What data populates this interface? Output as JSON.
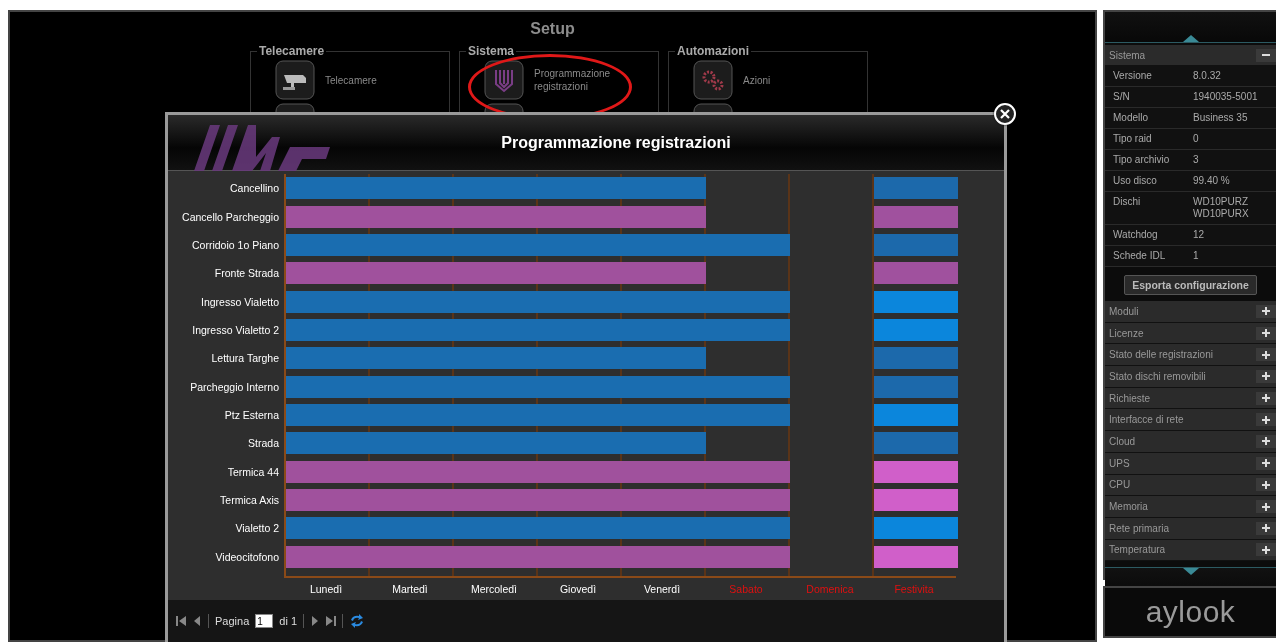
{
  "setup": {
    "title": "Setup",
    "groups": [
      {
        "title": "Telecamere",
        "items": [
          {
            "label": "Telecamere",
            "kind": "camera"
          }
        ]
      },
      {
        "title": "Sistema",
        "items": [
          {
            "label": "Programmazione registrazioni",
            "kind": "schedule"
          }
        ]
      },
      {
        "title": "Automazioni",
        "items": [
          {
            "label": "Azioni",
            "kind": "gears"
          }
        ]
      }
    ]
  },
  "dialog": {
    "title": "Programmazione registrazioni",
    "days": [
      {
        "label": "Lunedì",
        "weekend": false
      },
      {
        "label": "Martedì",
        "weekend": false
      },
      {
        "label": "Mercoledì",
        "weekend": false
      },
      {
        "label": "Giovedì",
        "weekend": false
      },
      {
        "label": "Venerdì",
        "weekend": false
      },
      {
        "label": "Sabato",
        "weekend": true
      },
      {
        "label": "Domenica",
        "weekend": true
      },
      {
        "label": "Festivita",
        "weekend": true
      }
    ],
    "rows": [
      {
        "name": "Cancellino",
        "color": "#1a6db0",
        "days": [
          true,
          true,
          true,
          true,
          true,
          false,
          false
        ],
        "holiday": {
          "color": "#1c69ab"
        }
      },
      {
        "name": "Cancello Parcheggio",
        "color": "#a0519d",
        "days": [
          true,
          true,
          true,
          true,
          true,
          false,
          false
        ],
        "holiday": {
          "color": "#a0519e"
        }
      },
      {
        "name": "Corridoio 1o Piano",
        "color": "#1a6db0",
        "days": [
          true,
          true,
          true,
          true,
          true,
          true,
          false
        ],
        "holiday": {
          "color": "#1c69ab"
        }
      },
      {
        "name": "Fronte Strada",
        "color": "#a0519d",
        "days": [
          true,
          true,
          true,
          true,
          true,
          false,
          false
        ],
        "holiday": {
          "color": "#a0519e"
        }
      },
      {
        "name": "Ingresso Vialetto",
        "color": "#1a6db0",
        "days": [
          true,
          true,
          true,
          true,
          true,
          true,
          false
        ],
        "holiday": {
          "color": "#0b86dc"
        }
      },
      {
        "name": "Ingresso Vialetto 2",
        "color": "#1a6db0",
        "days": [
          true,
          true,
          true,
          true,
          true,
          true,
          false
        ],
        "holiday": {
          "color": "#0b86dc"
        }
      },
      {
        "name": "Lettura Targhe",
        "color": "#1a6db0",
        "days": [
          true,
          true,
          true,
          true,
          true,
          false,
          false
        ],
        "holiday": {
          "color": "#1c69ab"
        }
      },
      {
        "name": "Parcheggio Interno",
        "color": "#1a6db0",
        "days": [
          true,
          true,
          true,
          true,
          true,
          true,
          false
        ],
        "holiday": {
          "color": "#1c69ab"
        }
      },
      {
        "name": "Ptz Esterna",
        "color": "#1a6db0",
        "days": [
          true,
          true,
          true,
          true,
          true,
          true,
          false
        ],
        "holiday": {
          "color": "#0b86dc"
        }
      },
      {
        "name": "Strada",
        "color": "#1a6db0",
        "days": [
          true,
          true,
          true,
          true,
          true,
          false,
          false
        ],
        "holiday": {
          "color": "#1c69ab"
        }
      },
      {
        "name": "Termica 44",
        "color": "#a0519d",
        "days": [
          true,
          true,
          true,
          true,
          true,
          true,
          false
        ],
        "holiday": {
          "color": "#d05fc9"
        }
      },
      {
        "name": "Termica Axis",
        "color": "#a0519d",
        "days": [
          true,
          true,
          true,
          true,
          true,
          true,
          false
        ],
        "holiday": {
          "color": "#d05fc9"
        }
      },
      {
        "name": "Vialetto 2",
        "color": "#1a6db0",
        "days": [
          true,
          true,
          true,
          true,
          true,
          true,
          false
        ],
        "holiday": {
          "color": "#0b86dc"
        }
      },
      {
        "name": "Videocitofono",
        "color": "#a0519d",
        "days": [
          true,
          true,
          true,
          true,
          true,
          true,
          false
        ],
        "holiday": {
          "color": "#d05fc9"
        }
      }
    ],
    "pager": {
      "page_label": "Pagina",
      "page": "1",
      "total": "di 1"
    }
  },
  "sidebar": {
    "section": {
      "title": "Sistema",
      "expanded": true
    },
    "info": [
      {
        "label": "Versione",
        "value": "8.0.32"
      },
      {
        "label": "S/N",
        "value": "1940035-5001"
      },
      {
        "label": "Modello",
        "value": "Business 35"
      },
      {
        "label": "Tipo raid",
        "value": "0"
      },
      {
        "label": "Tipo archivio",
        "value": "3"
      },
      {
        "label": "Uso disco",
        "value": "99.40 %"
      },
      {
        "label": "Dischi",
        "value": "WD10PURZ\nWD10PURX"
      },
      {
        "label": "Watchdog",
        "value": "12"
      },
      {
        "label": "Schede IDL",
        "value": "1"
      }
    ],
    "export_button": "Esporta configurazione",
    "sections": [
      {
        "title": "Moduli",
        "expanded": false
      },
      {
        "title": "Licenze",
        "expanded": false
      },
      {
        "title": "Stato delle registrazioni",
        "expanded": false
      },
      {
        "title": "Stato dischi removibili",
        "expanded": false
      },
      {
        "title": "Richieste",
        "expanded": false
      },
      {
        "title": "Interfacce di rete",
        "expanded": false
      },
      {
        "title": "Cloud",
        "expanded": false
      },
      {
        "title": "UPS",
        "expanded": false
      },
      {
        "title": "CPU",
        "expanded": false
      },
      {
        "title": "Memoria",
        "expanded": false
      },
      {
        "title": "Rete primaria",
        "expanded": false
      },
      {
        "title": "Temperatura",
        "expanded": false
      }
    ],
    "logo": "aylook"
  }
}
